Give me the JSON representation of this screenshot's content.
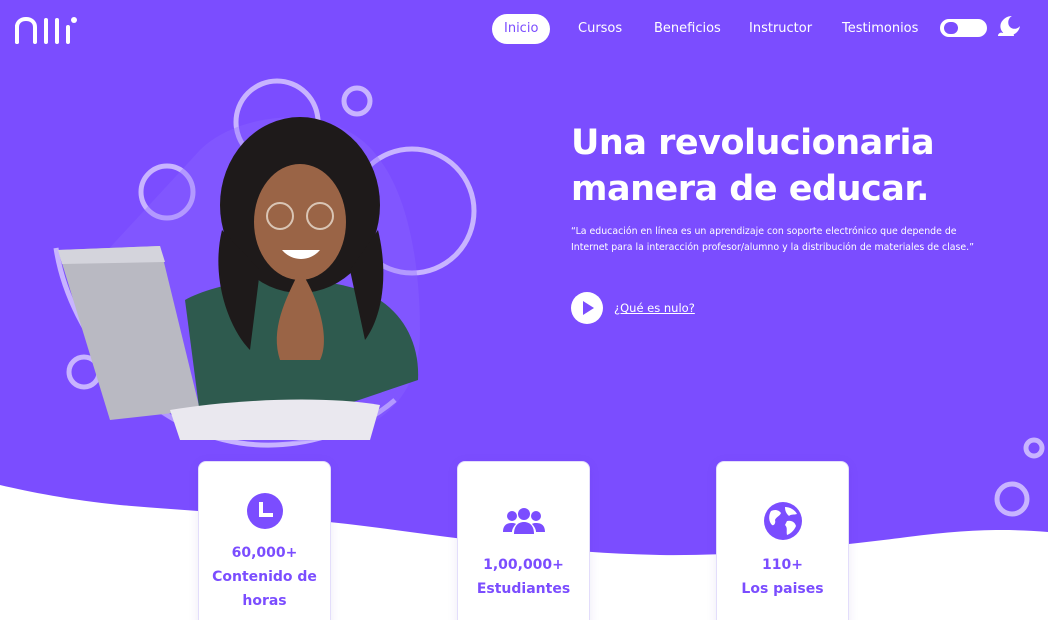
{
  "nav": {
    "items": [
      {
        "label": "Inicio",
        "active": true
      },
      {
        "label": "Cursos",
        "active": false
      },
      {
        "label": "Beneficios",
        "active": false
      },
      {
        "label": "Instructor",
        "active": false
      },
      {
        "label": "Testimonios",
        "active": false
      }
    ],
    "theme_toggle": "off",
    "theme_icon": "moon-icon"
  },
  "hero": {
    "title_line1": "Una revolucionaria",
    "title_line2": "manera de educar.",
    "quote_line1": "“La educación en línea es un aprendizaje con soporte electrónico que depende de",
    "quote_line2": "Internet para la interacción profesor/alumno y la distribución de materiales de clase.”",
    "video_link": "¿Qué es nulo?"
  },
  "stats": [
    {
      "icon": "clock-icon",
      "value": "60,000+",
      "label_line1": "Contenido de",
      "label_line2": "horas"
    },
    {
      "icon": "users-icon",
      "value": "1,00,000+",
      "label_line1": "Estudiantes",
      "label_line2": ""
    },
    {
      "icon": "globe-icon",
      "value": "110+",
      "label_line1": "Los paises",
      "label_line2": ""
    }
  ],
  "colors": {
    "brand": "#7b4dff",
    "circle_stroke": "#c8b4ff",
    "text_on_brand": "#ffffff"
  }
}
